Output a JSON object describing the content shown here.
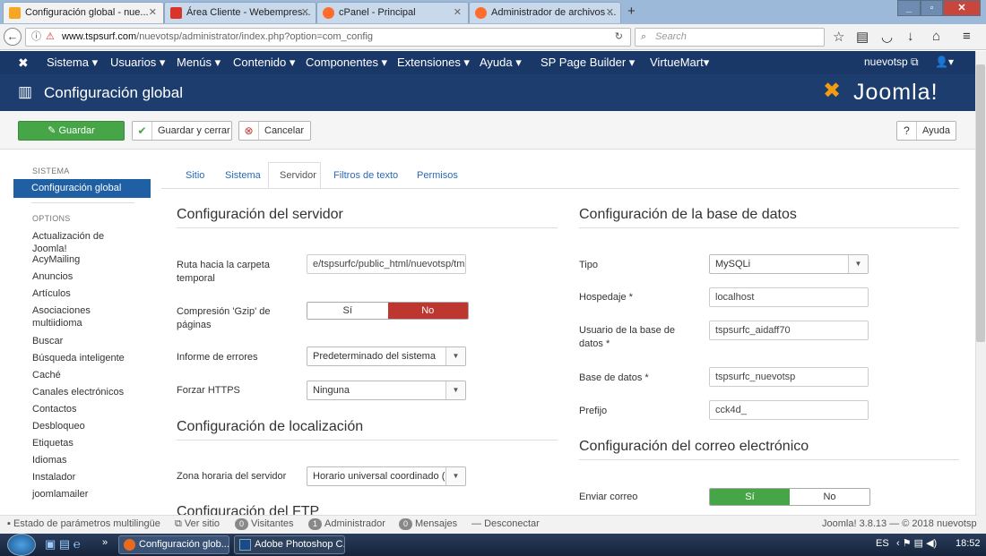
{
  "browser": {
    "tabs": [
      {
        "label": "Configuración global - nue...",
        "color": "#4a90d9"
      },
      {
        "label": "Área Cliente - Webempres...",
        "color": "#d9342b"
      },
      {
        "label": "cPanel - Principal",
        "color": "#ff6c2c"
      },
      {
        "label": "Administrador de archivos ...",
        "color": "#ff6c2c"
      }
    ],
    "url_domain": "www.tspsurf.com",
    "url_path": "/nuevotsp/administrator/index.php?option=com_config",
    "search_placeholder": "Search"
  },
  "jnav": {
    "items": [
      "Sistema ▾",
      "Usuarios ▾",
      "Menús ▾",
      "Contenido ▾",
      "Componentes ▾",
      "Extensiones ▾",
      "Ayuda ▾",
      "SP Page Builder ▾",
      "VirtueMart▾"
    ],
    "user": "nuevotsp ⧉"
  },
  "header": {
    "title": "Configuración global",
    "logo_text": "Joomla!"
  },
  "toolbar": {
    "save": "Guardar",
    "save_close": "Guardar y cerrar",
    "cancel": "Cancelar",
    "help": "Ayuda"
  },
  "sidebar": {
    "system_head": "SISTEMA",
    "active": "Configuración global",
    "options_head": "OPTIONS",
    "items": [
      "Actualización de Joomla!",
      "AcyMailing",
      "Anuncios",
      "Artículos",
      "Asociaciones multiidioma",
      "Buscar",
      "Búsqueda inteligente",
      "Caché",
      "Canales electrónicos",
      "Contactos",
      "Desbloqueo",
      "Etiquetas",
      "Idiomas",
      "Instalador",
      "joomlamailer"
    ]
  },
  "tabs": [
    "Sitio",
    "Sistema",
    "Servidor",
    "Filtros de texto",
    "Permisos"
  ],
  "server": {
    "heading": "Configuración del servidor",
    "tmp_label": "Ruta hacia la carpeta temporal",
    "tmp_value": "e/tspsurfc/public_html/nuevotsp/tmp",
    "gzip_label": "Compresión 'Gzip' de páginas",
    "gzip_yes": "Sí",
    "gzip_no": "No",
    "errors_label": "Informe de errores",
    "errors_value": "Predeterminado del sistema",
    "https_label": "Forzar HTTPS",
    "https_value": "Ninguna"
  },
  "locale": {
    "heading": "Configuración de localización",
    "tz_label": "Zona horaria del servidor",
    "tz_value": "Horario universal coordinado (..."
  },
  "ftp": {
    "heading": "Configuración del FTP"
  },
  "database": {
    "heading": "Configuración de la base de datos",
    "type_label": "Tipo",
    "type_value": "MySQLi",
    "host_label": "Hospedaje *",
    "host_value": "localhost",
    "user_label": "Usuario de la base de datos *",
    "user_value": "tspsurfc_aidaff70",
    "db_label": "Base de datos *",
    "db_value": "tspsurfc_nuevotsp",
    "prefix_label": "Prefijo",
    "prefix_value": "cck4d_"
  },
  "mail": {
    "heading": "Configuración del correo electrónico",
    "send_label": "Enviar correo",
    "send_yes": "Sí",
    "send_no": "No"
  },
  "statusbar": {
    "multilang": "Estado de parámetros multilingüe",
    "view_site": "Ver sitio",
    "visitors_count": "0",
    "visitors": "Visitantes",
    "admin_count": "1",
    "admin": "Administrador",
    "messages_count": "0",
    "messages": "Mensajes",
    "logout": "Desconectar",
    "version": "Joomla! 3.8.13 — © 2018 nuevotsp"
  },
  "taskbar": {
    "item1": "Configuración glob...",
    "item2": "Adobe Photoshop C...",
    "lang": "ES",
    "time": "18:52"
  },
  "colors": {
    "green": "#46a546",
    "red": "#bd362f",
    "navy": "#1a3867",
    "blue": "#1f5fa3"
  }
}
